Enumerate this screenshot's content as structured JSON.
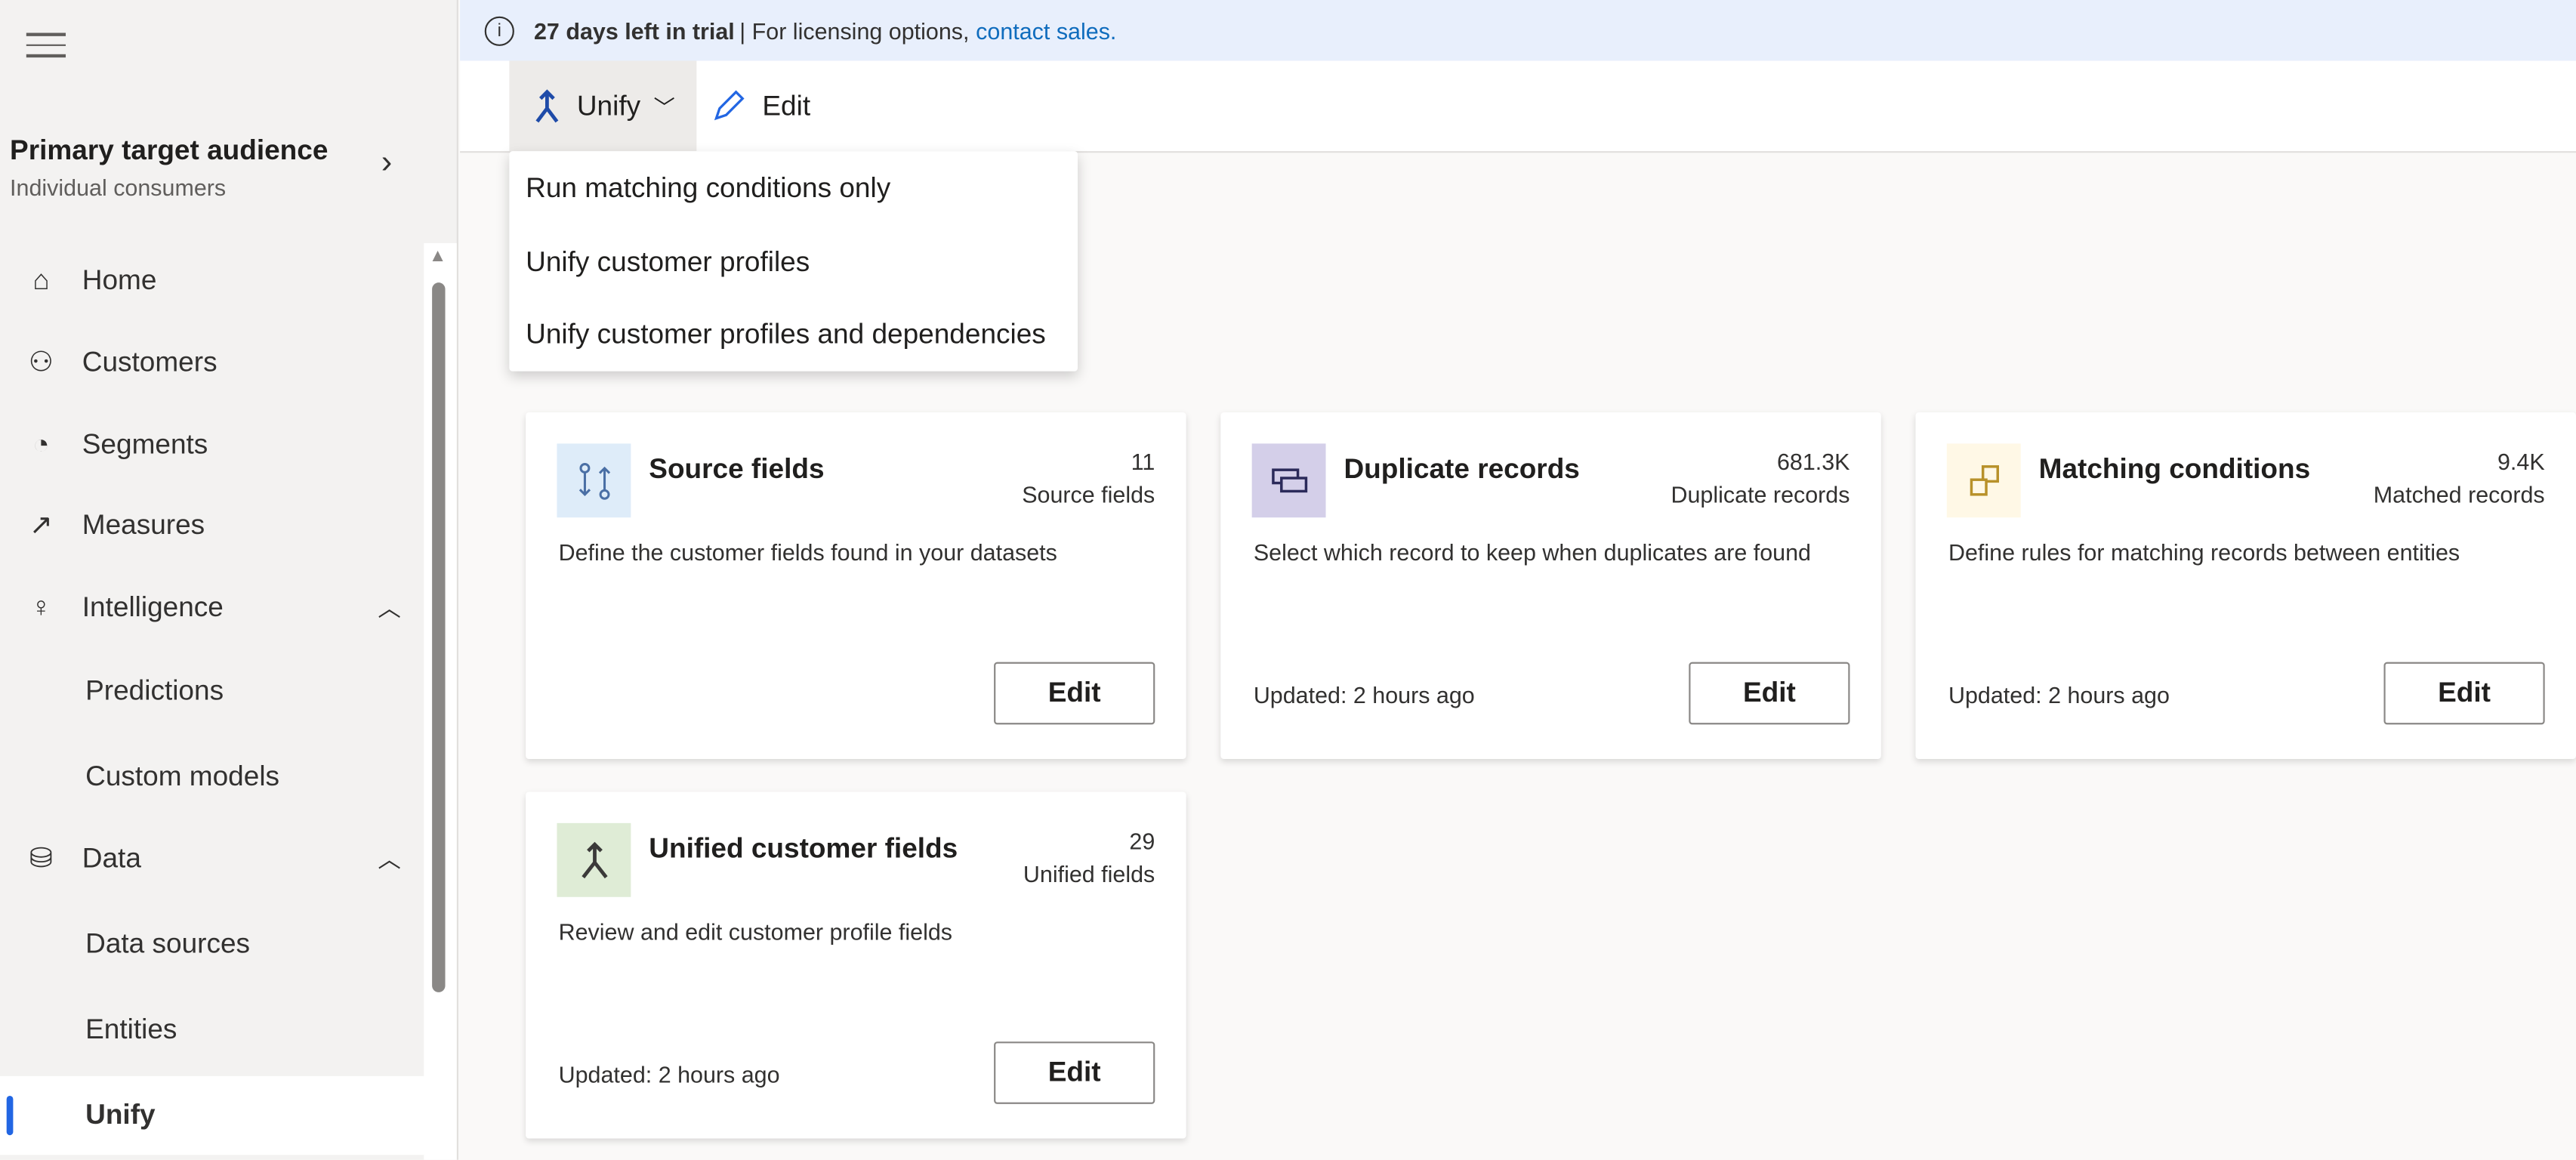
{
  "banner": {
    "bold": "27 days left in trial",
    "sep": " | For licensing options,",
    "link": "contact sales."
  },
  "sidebar": {
    "audience_title": "Primary target audience",
    "audience_sub": "Individual consumers",
    "items": [
      {
        "label": "Home",
        "icon": "home-icon"
      },
      {
        "label": "Customers",
        "icon": "people-icon"
      },
      {
        "label": "Segments",
        "icon": "segments-icon"
      },
      {
        "label": "Measures",
        "icon": "chart-icon"
      },
      {
        "label": "Intelligence",
        "icon": "lightbulb-icon",
        "expanded": true
      },
      {
        "label": "Predictions"
      },
      {
        "label": "Custom models"
      },
      {
        "label": "Data",
        "icon": "database-icon",
        "expanded": true
      },
      {
        "label": "Data sources"
      },
      {
        "label": "Entities"
      },
      {
        "label": "Unify",
        "selected": true
      }
    ]
  },
  "toolbar": {
    "unify_label": "Unify",
    "edit_label": "Edit"
  },
  "menu": [
    "Run matching conditions only",
    "Unify customer profiles",
    "Unify customer profiles and dependencies"
  ],
  "cards": [
    {
      "title": "Source fields",
      "count": "11",
      "count_label": "Source fields",
      "desc": "Define the customer fields found in your datasets",
      "updated": "",
      "edit": "Edit",
      "icon_bg": "#deecf9"
    },
    {
      "title": "Duplicate records",
      "count": "681.3K",
      "count_label": "Duplicate records",
      "desc": "Select which record to keep when duplicates are found",
      "updated": "Updated: 2 hours ago",
      "edit": "Edit",
      "icon_bg": "#d4cfe9"
    },
    {
      "title": "Matching conditions",
      "count": "9.4K",
      "count_label": "Matched records",
      "desc": "Define rules for matching records between entities",
      "updated": "Updated: 2 hours ago",
      "edit": "Edit",
      "icon_bg": "#fff8e6"
    },
    {
      "title": "Unified customer fields",
      "count": "29",
      "count_label": "Unified fields",
      "desc": "Review and edit customer profile fields",
      "updated": "Updated: 2 hours ago",
      "edit": "Edit",
      "icon_bg": "#dfecd6"
    }
  ]
}
